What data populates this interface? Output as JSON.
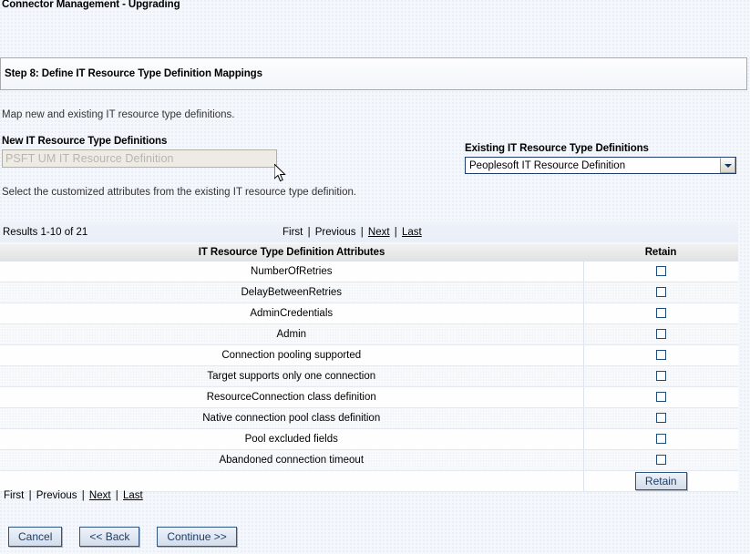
{
  "window": {
    "title": "Connector Management - Upgrading"
  },
  "step_header": {
    "title": "Step 8: Define IT Resource Type Definition Mappings"
  },
  "intro": {
    "text": "Map new and existing IT resource type definitions."
  },
  "mapping": {
    "new_label": "New IT Resource Type Definitions",
    "new_value": "PSFT UM IT Resource Definition",
    "existing_label": "Existing IT Resource Type Definitions",
    "existing_selected": "Peoplesoft IT Resource Definition",
    "note": "Select the customized attributes from the existing IT resource type definition."
  },
  "results": {
    "count_text": "Results 1-10 of 21"
  },
  "pager": {
    "first": "First",
    "previous": "Previous",
    "next": "Next",
    "last": "Last",
    "separator": "|"
  },
  "table": {
    "headers": {
      "attributes": "IT Resource Type Definition Attributes",
      "retain": "Retain"
    },
    "rows": [
      {
        "attribute": "NumberOfRetries",
        "retain": false
      },
      {
        "attribute": "DelayBetweenRetries",
        "retain": false
      },
      {
        "attribute": "AdminCredentials",
        "retain": false
      },
      {
        "attribute": "Admin",
        "retain": false
      },
      {
        "attribute": "Connection pooling supported",
        "retain": false
      },
      {
        "attribute": "Target supports only one connection",
        "retain": false
      },
      {
        "attribute": "ResourceConnection class definition",
        "retain": false
      },
      {
        "attribute": "Native connection pool class definition",
        "retain": false
      },
      {
        "attribute": "Pool excluded fields",
        "retain": false
      },
      {
        "attribute": "Abandoned connection timeout",
        "retain": false
      }
    ],
    "retain_button": "Retain"
  },
  "footer_buttons": {
    "cancel": "Cancel",
    "back": "<< Back",
    "continue": "Continue >>"
  },
  "colors": {
    "page_background": "#f4f7fc",
    "button_border": "#30557e",
    "button_text": "#1d3c63",
    "checkbox_border": "#1f4d77",
    "readonly_field_bg": "#edebe3",
    "readonly_field_text": "#b7b5ad",
    "select_border": "#1f3d6b"
  }
}
